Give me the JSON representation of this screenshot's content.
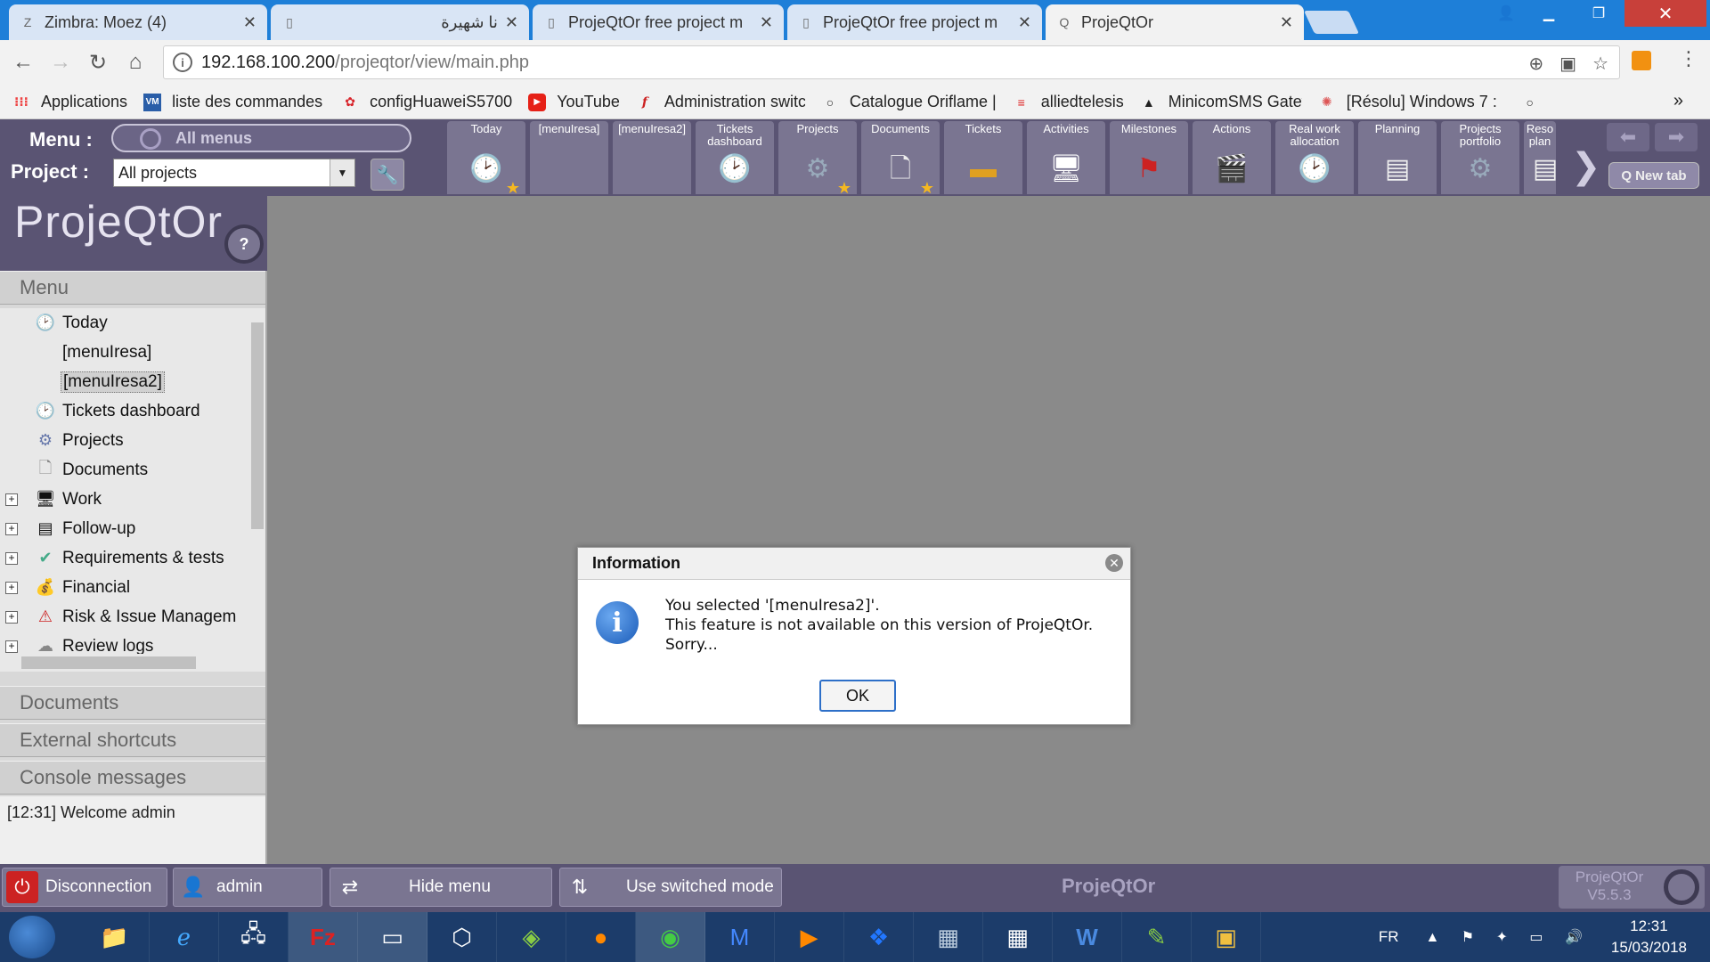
{
  "browser": {
    "tabs": [
      {
        "title": "Zimbra: Moez (4)",
        "icon": "zimbra-icon"
      },
      {
        "title": "نا شهيرة",
        "icon": "page-icon"
      },
      {
        "title": "ProjeQtOr free project m",
        "icon": "page-icon"
      },
      {
        "title": "ProjeQtOr free project m",
        "icon": "page-icon"
      },
      {
        "title": "ProjeQtOr",
        "icon": "projeqtor-icon"
      }
    ],
    "url_host": "192.168.100.200",
    "url_path": "/projeqtor/view/main.php",
    "bookmarks": [
      {
        "label": "Applications",
        "icon": "apps-grid-icon"
      },
      {
        "label": "liste des commandes",
        "icon": "vm-icon"
      },
      {
        "label": "configHuaweiS5700",
        "icon": "huawei-icon"
      },
      {
        "label": "YouTube",
        "icon": "youtube-icon"
      },
      {
        "label": "Administration switch",
        "icon": "f-icon"
      },
      {
        "label": "Catalogue Oriflame |",
        "icon": "circle-icon"
      },
      {
        "label": "alliedtelesis",
        "icon": "allied-icon"
      },
      {
        "label": "MinicomSMS Gatewa",
        "icon": "minicom-icon"
      },
      {
        "label": "[Résolu] Windows 7 :",
        "icon": "resolu-icon"
      }
    ],
    "bookmarks_more": "»"
  },
  "app": {
    "menu_label": "Menu :",
    "all_menus": "All menus",
    "project_label": "Project :",
    "project_value": "All projects",
    "toolbar": [
      {
        "label": "Today",
        "icon": "clock-icon",
        "star": true
      },
      {
        "label": "[menuIresa]",
        "icon": "",
        "star": false
      },
      {
        "label": "[menuIresa2]",
        "icon": "",
        "star": false
      },
      {
        "label": "Tickets dashboard",
        "icon": "dashboard-icon",
        "star": false
      },
      {
        "label": "Projects",
        "icon": "gear-icon",
        "star": true
      },
      {
        "label": "Documents",
        "icon": "document-icon",
        "star": true
      },
      {
        "label": "Tickets",
        "icon": "ticket-icon",
        "star": false
      },
      {
        "label": "Activities",
        "icon": "computer-icon",
        "star": false
      },
      {
        "label": "Milestones",
        "icon": "flag-icon",
        "star": false
      },
      {
        "label": "Actions",
        "icon": "clapper-icon",
        "star": false
      },
      {
        "label": "Real work allocation",
        "icon": "work-allocation-icon",
        "star": false
      },
      {
        "label": "Planning",
        "icon": "gantt-icon",
        "star": false
      },
      {
        "label": "Projects portfolio",
        "icon": "portfolio-icon",
        "star": false
      },
      {
        "label": "Reso plan",
        "icon": "resource-plan-icon",
        "star": false
      }
    ],
    "new_tab": "New tab",
    "logo": "ProjeQtOr",
    "help": "?",
    "accordion": {
      "menu": "Menu",
      "documents": "Documents",
      "external_shortcuts": "External shortcuts",
      "console_messages": "Console messages"
    },
    "tree": [
      {
        "label": "Today",
        "icon": "clock-icon",
        "expandable": false,
        "selected": false
      },
      {
        "label": "[menuIresa]",
        "icon": "",
        "expandable": false,
        "selected": false
      },
      {
        "label": "[menuIresa2]",
        "icon": "",
        "expandable": false,
        "selected": true
      },
      {
        "label": "Tickets dashboard",
        "icon": "dashboard-icon",
        "expandable": false,
        "selected": false
      },
      {
        "label": "Projects",
        "icon": "gear-icon",
        "expandable": false,
        "selected": false
      },
      {
        "label": "Documents",
        "icon": "document-icon",
        "expandable": false,
        "selected": false
      },
      {
        "label": "Work",
        "icon": "computer-icon",
        "expandable": true,
        "selected": false
      },
      {
        "label": "Follow-up",
        "icon": "gantt-icon",
        "expandable": true,
        "selected": false
      },
      {
        "label": "Requirements & tests",
        "icon": "requirements-icon",
        "expandable": true,
        "selected": false
      },
      {
        "label": "Financial",
        "icon": "money-bag-icon",
        "expandable": true,
        "selected": false
      },
      {
        "label": "Risk & Issue Managem",
        "icon": "warning-icon",
        "expandable": true,
        "selected": false
      },
      {
        "label": "Review logs",
        "icon": "review-icon",
        "expandable": true,
        "selected": false
      }
    ],
    "console_message": "[12:31] Welcome admin",
    "bottom": {
      "disconnection": "Disconnection",
      "user": "admin",
      "hide_menu": "Hide menu",
      "switched_mode": "Use switched mode",
      "title": "ProjeQtOr",
      "version_name": "ProjeQtOr",
      "version": "V5.5.3"
    },
    "dialog": {
      "title": "Information",
      "line1": "You selected '[menuIresa2]'.",
      "line2": "This feature is not available on this version of ProjeQtOr.",
      "line3": "Sorry...",
      "ok": "OK"
    }
  },
  "taskbar": {
    "apps": [
      "explorer-icon",
      "ie-icon",
      "network-icon",
      "filezilla-icon",
      "cmd-icon",
      "virtualbox-icon",
      "vsphere-icon",
      "firefox-icon",
      "chrome-icon",
      "malwarebytes-icon",
      "media-player-icon",
      "dropbox-icon",
      "app-icon",
      "calculator-icon",
      "word-icon",
      "notepad-icon",
      "folder-yellow-icon"
    ],
    "language": "FR",
    "time": "12:31",
    "date": "15/03/2018"
  },
  "colors": {
    "chrome_tabbar": "#1e7fd8",
    "app_header": "#5a5473",
    "toolbar_item": "#7a7591",
    "workarea": "#8a8a8a",
    "taskbar": "#1c3c6a"
  }
}
